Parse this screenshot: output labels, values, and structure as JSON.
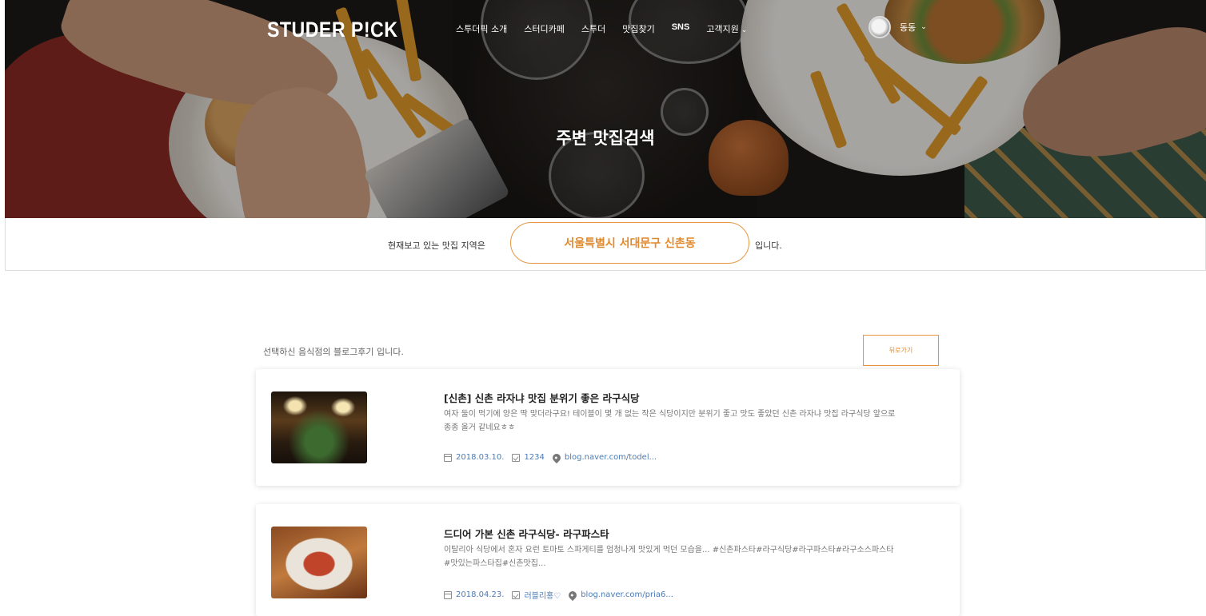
{
  "nav": {
    "logo": "STUDER P!CK",
    "menu": [
      "스투더픽 소개",
      "스터디카페",
      "스투더",
      "맛집찾기",
      "SNS",
      "고객지원"
    ],
    "user_name": "동동"
  },
  "hero": {
    "title": "주변 맛집검색"
  },
  "location": {
    "prefix": "현재보고 있는 맛집 지역은",
    "area": "서울특별시 서대문구 신촌동",
    "suffix": "입니다."
  },
  "content": {
    "intro": "선택하신 음식점의 블로그후기 입니다.",
    "back_label": "뒤로가기",
    "posts": [
      {
        "title": "[신촌] 신촌 라자냐 맛집 분위기 좋은 라구식당",
        "desc": "여자 둘이 먹기에 양은 딱 맞더라구요! 테이블이 몇 개 없는 작은 식당이지만 분위기 좋고 맛도 좋았던 신촌 라자냐 맛집 라구식당 앞으로 종종 올거 같네요ㅎㅎ",
        "date": "2018.03.10.",
        "author": "1234",
        "link": "blog.naver.com/todel..."
      },
      {
        "title": "드디어 가본 신촌 라구식당- 라구파스타",
        "desc": "이탈리아 식당에서 혼자 요런 토마토 스파게티를 엄청나게 맛있게 먹던 모습을... #신촌파스타#라구식당#라구파스타#라구소스파스타#맛있는파스타집#신촌맛집...",
        "date": "2018.04.23.",
        "author": "러블리홍♡",
        "link": "blog.naver.com/pria6..."
      }
    ]
  },
  "colors": {
    "accent": "#e08a2f",
    "link": "#4a7bb7"
  }
}
